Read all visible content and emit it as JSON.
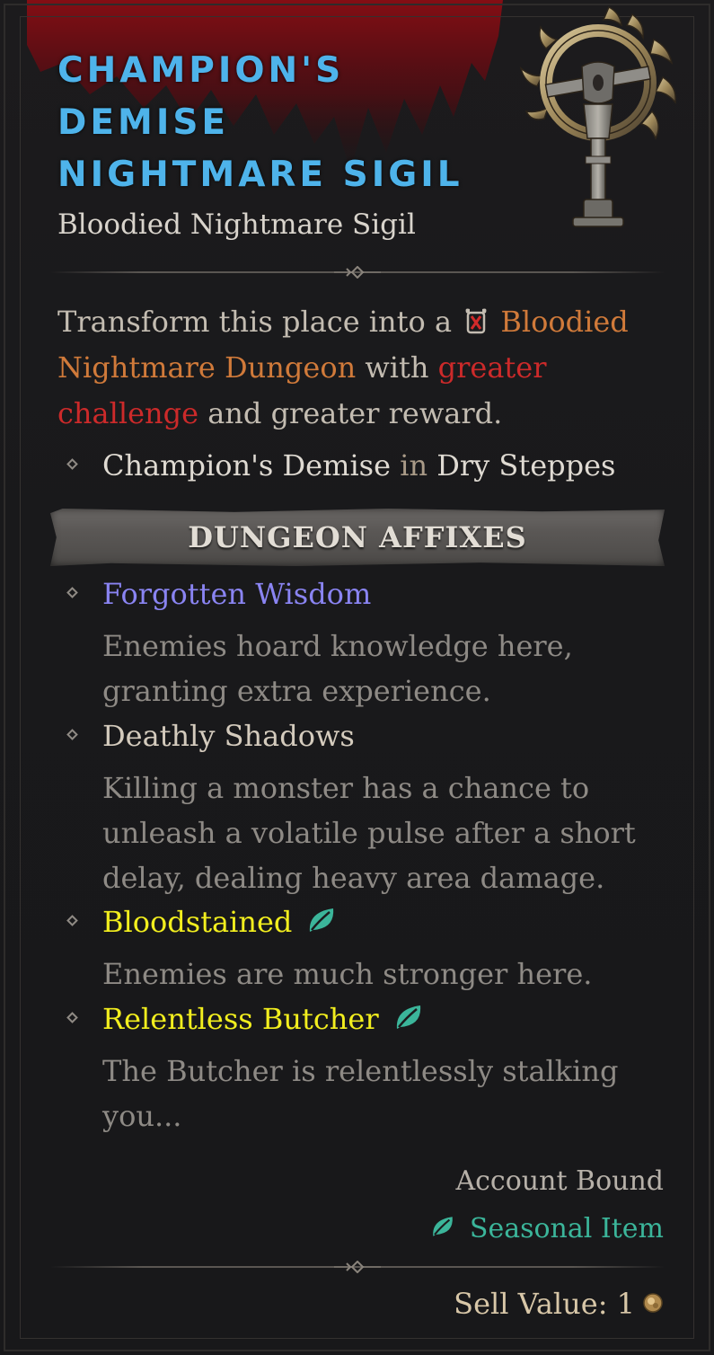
{
  "item": {
    "name_lines": [
      "Champion's",
      "Demise",
      "Nightmare Sigil"
    ],
    "type": "Bloodied Nightmare Sigil",
    "image_icon": "nightmare-sigil-icon"
  },
  "description": {
    "part1": "Transform this place into a ",
    "icon": "bloodied-dungeon-icon",
    "dungeon_name": "Bloodied Nightmare Dungeon",
    "part2": " with ",
    "challenge": "greater challenge",
    "part3": " and greater reward."
  },
  "location": {
    "dungeon": "Champion's Demise",
    "connector": " in ",
    "region": "Dry Steppes"
  },
  "affixes_header": "DUNGEON AFFIXES",
  "affixes": [
    {
      "name": "Forgotten Wisdom",
      "description": "Enemies hoard knowledge here, granting extra experience.",
      "seasonal": false,
      "color": "#8a84f2"
    },
    {
      "name": "Deathly Shadows",
      "description": "Killing a monster has a chance to unleash a volatile pulse after a short delay, dealing heavy area damage.",
      "seasonal": false,
      "color": "#d4cbbd"
    },
    {
      "name": "Bloodstained",
      "description": "Enemies are much stronger here.",
      "seasonal": true,
      "color": "#f2ee1e"
    },
    {
      "name": "Relentless Butcher",
      "description": "The Butcher is relentlessly stalking you...",
      "seasonal": true,
      "color": "#f2ee1e"
    }
  ],
  "footer": {
    "account_bound": "Account Bound",
    "seasonal_label": "Seasonal Item",
    "sell_label": "Sell Value:",
    "sell_value": "1",
    "coin_icon": "gold-coin-icon"
  },
  "colors": {
    "title": "#4eb3ea",
    "dungeon": "#d07a3a",
    "challenge": "#cc2a2a",
    "seasonal": "#3bb59a"
  }
}
